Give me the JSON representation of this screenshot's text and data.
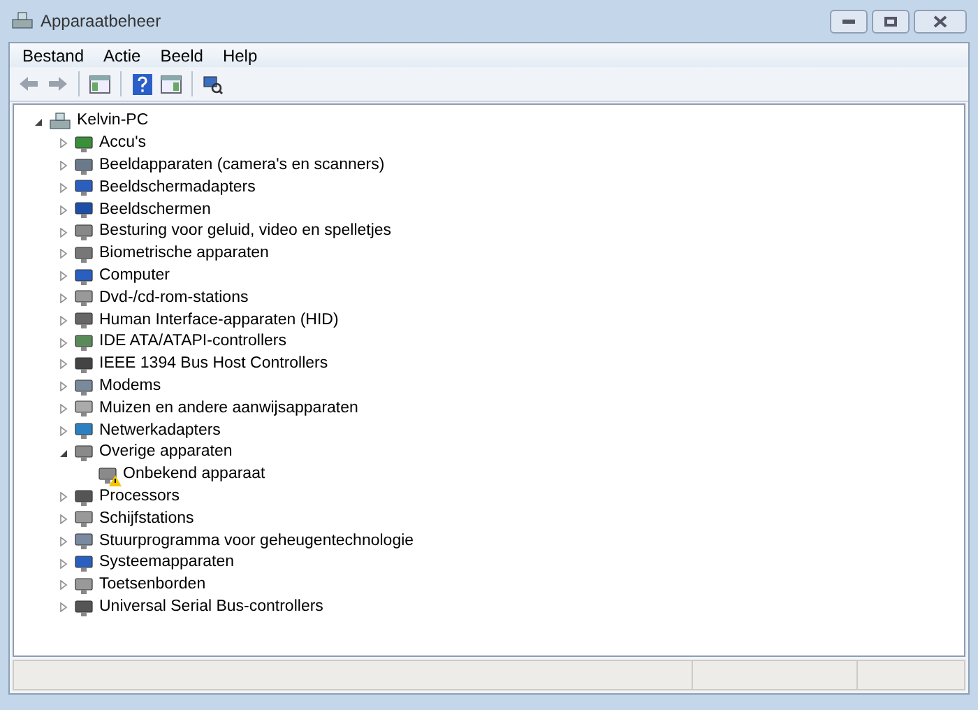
{
  "window": {
    "title": "Apparaatbeheer"
  },
  "menu": [
    "Bestand",
    "Actie",
    "Beeld",
    "Help"
  ],
  "toolbar": [
    {
      "kind": "back",
      "disabled": true
    },
    {
      "kind": "forward",
      "disabled": true
    },
    {
      "kind": "separator"
    },
    {
      "kind": "tree"
    },
    {
      "kind": "separator"
    },
    {
      "kind": "help"
    },
    {
      "kind": "pane"
    },
    {
      "kind": "separator"
    },
    {
      "kind": "scan"
    }
  ],
  "tree": {
    "label": "Kelvin-PC",
    "expanded": true,
    "children": [
      {
        "label": "Accu's",
        "expanded": false
      },
      {
        "label": "Beeldapparaten (camera's en scanners)",
        "expanded": false
      },
      {
        "label": "Beeldschermadapters",
        "expanded": false
      },
      {
        "label": "Beeldschermen",
        "expanded": false
      },
      {
        "label": "Besturing voor geluid, video en spelletjes",
        "expanded": false
      },
      {
        "label": "Biometrische apparaten",
        "expanded": false
      },
      {
        "label": "Computer",
        "expanded": false
      },
      {
        "label": "Dvd-/cd-rom-stations",
        "expanded": false
      },
      {
        "label": "Human Interface-apparaten (HID)",
        "expanded": false
      },
      {
        "label": "IDE ATA/ATAPI-controllers",
        "expanded": false
      },
      {
        "label": "IEEE 1394 Bus Host Controllers",
        "expanded": false
      },
      {
        "label": "Modems",
        "expanded": false
      },
      {
        "label": "Muizen en andere aanwijsapparaten",
        "expanded": false
      },
      {
        "label": "Netwerkadapters",
        "expanded": false
      },
      {
        "label": "Overige apparaten",
        "expanded": true,
        "children": [
          {
            "label": "Onbekend apparaat",
            "warning": true
          }
        ]
      },
      {
        "label": "Processors",
        "expanded": false
      },
      {
        "label": "Schijfstations",
        "expanded": false
      },
      {
        "label": "Stuurprogramma voor geheugentechnologie",
        "expanded": false
      },
      {
        "label": "Systeemapparaten",
        "expanded": false
      },
      {
        "label": "Toetsenborden",
        "expanded": false
      },
      {
        "label": "Universal Serial Bus-controllers",
        "expanded": false
      }
    ]
  }
}
